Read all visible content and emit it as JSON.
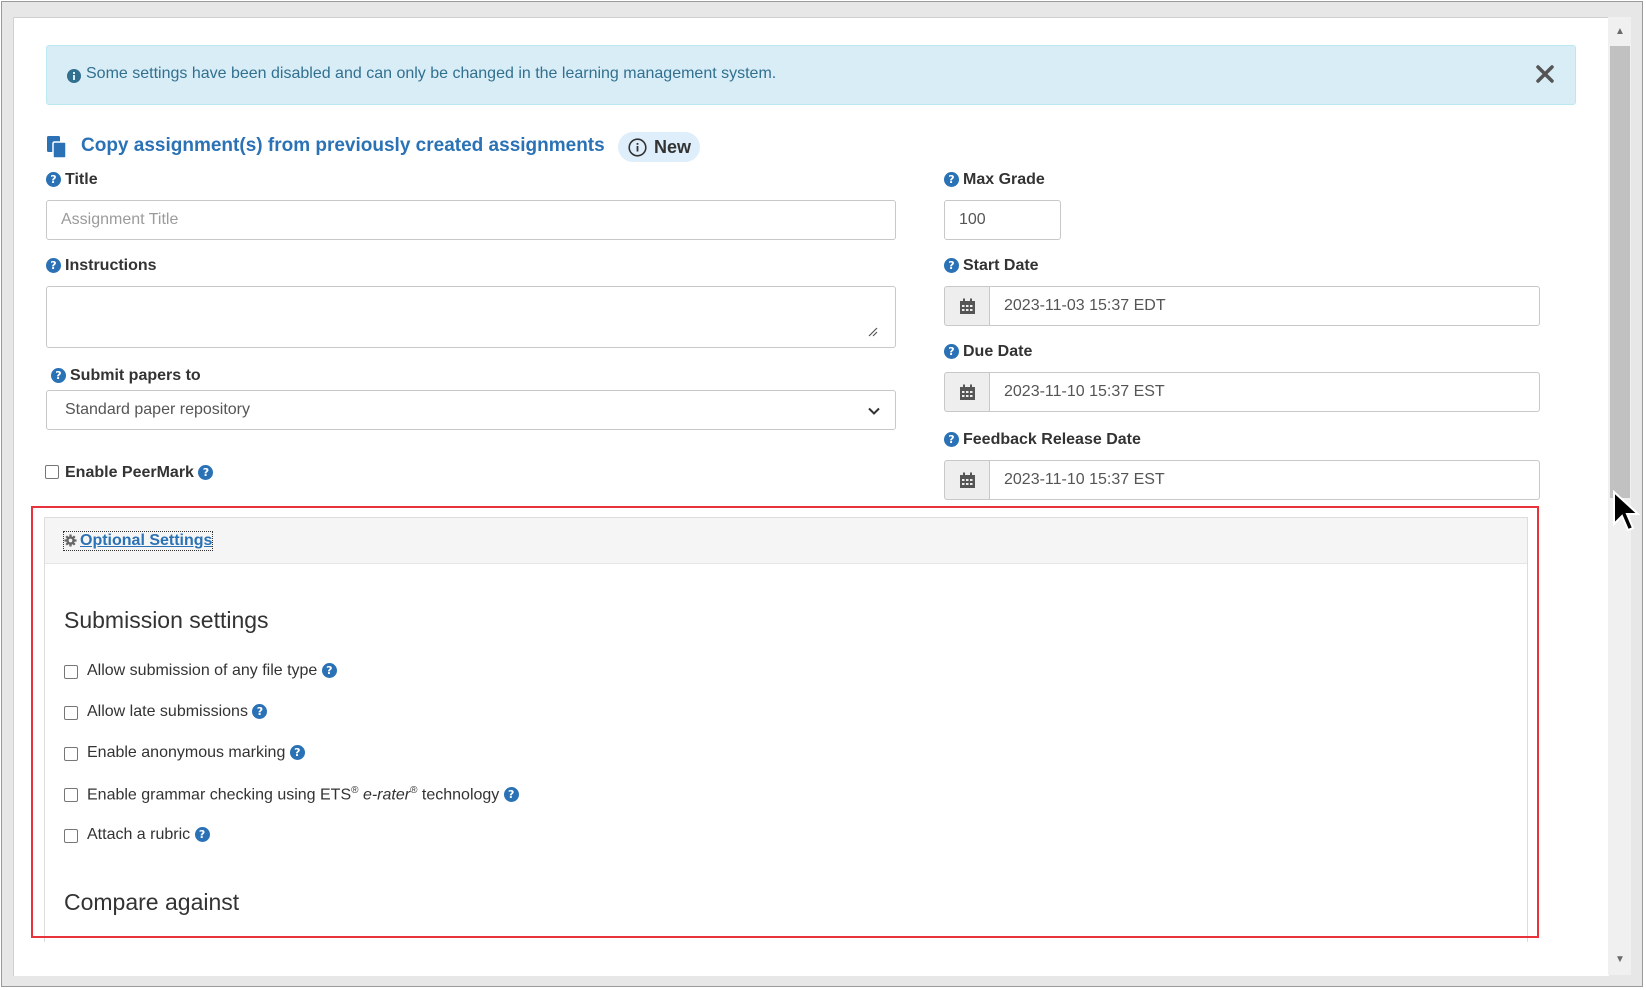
{
  "alert": {
    "message": "Some settings have been disabled and can only be changed in the learning management system."
  },
  "copy": {
    "link_text": "Copy assignment(s) from previously created assignments",
    "badge": "New"
  },
  "form": {
    "title": {
      "label": "Title",
      "placeholder": "Assignment Title",
      "value": ""
    },
    "instructions": {
      "label": "Instructions",
      "value": ""
    },
    "submit_to": {
      "label": "Submit papers to",
      "selected": "Standard paper repository"
    },
    "peermark": {
      "label": "Enable PeerMark",
      "checked": false
    },
    "max_grade": {
      "label": "Max Grade",
      "value": "100"
    },
    "start_date": {
      "label": "Start Date",
      "value": "2023-11-03 15:37 EDT"
    },
    "due_date": {
      "label": "Due Date",
      "value": "2023-11-10 15:37 EST"
    },
    "feedback_date": {
      "label": "Feedback Release Date",
      "value": "2023-11-10 15:37 EST"
    }
  },
  "optional": {
    "toggle_label": "Optional Settings",
    "submission_heading": "Submission settings",
    "options": [
      {
        "label": "Allow submission of any file type",
        "checked": false
      },
      {
        "label": "Allow late submissions",
        "checked": false
      },
      {
        "label": "Enable anonymous marking",
        "checked": false
      },
      {
        "label_pre": "Enable grammar checking using ETS",
        "sup1": "®",
        "label_em": " e-rater",
        "sup2": "®",
        "label_post": " technology",
        "checked": false
      },
      {
        "label": "Attach a rubric",
        "checked": false
      }
    ],
    "compare_heading": "Compare against"
  },
  "colors": {
    "accent": "#2a72b5",
    "alert_bg": "#d9edf7",
    "alert_text": "#31708f",
    "highlight_border": "#e8323c"
  }
}
